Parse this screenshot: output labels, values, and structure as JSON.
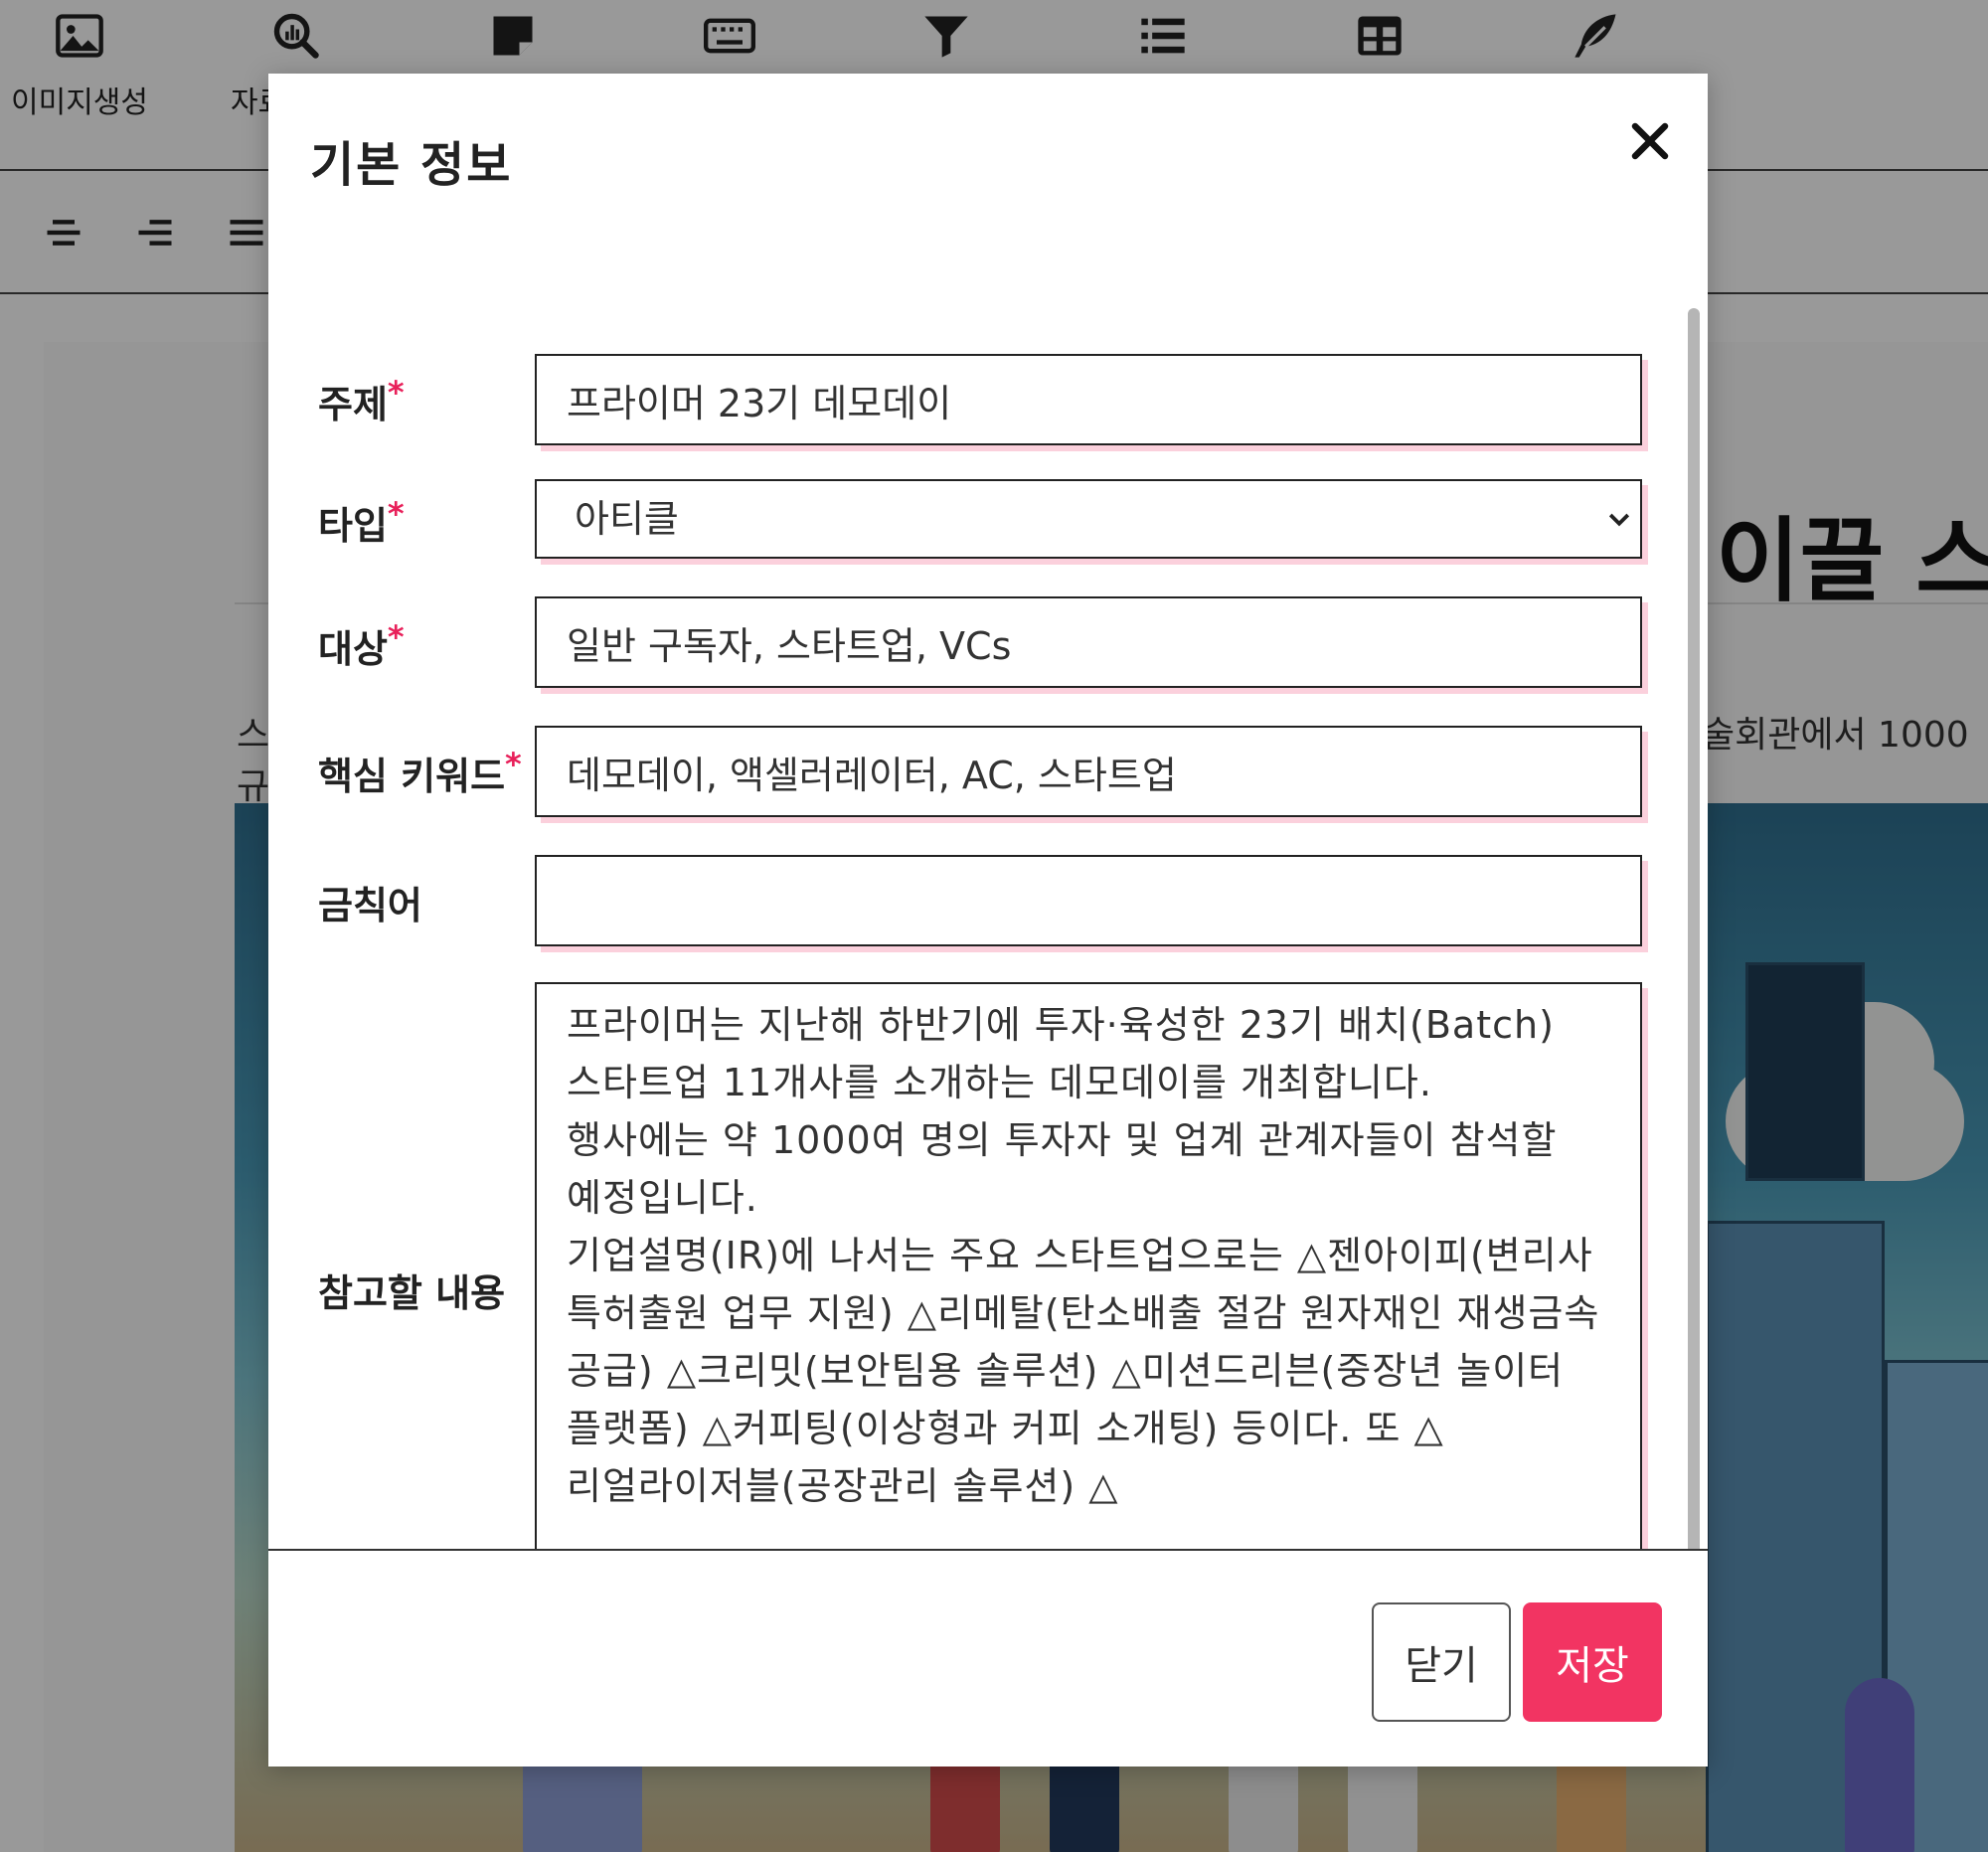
{
  "toolbar": {
    "items": [
      {
        "label": "이미지생성",
        "icon": "image-icon"
      },
      {
        "label": "자료",
        "icon": "search-chart-icon"
      },
      {
        "label": "",
        "icon": "note-icon"
      },
      {
        "label": "",
        "icon": "keyboard-icon"
      },
      {
        "label": "",
        "icon": "filter-icon"
      },
      {
        "label": "",
        "icon": "list-icon"
      },
      {
        "label": "",
        "icon": "table-icon"
      },
      {
        "label": "",
        "icon": "feather-icon"
      }
    ]
  },
  "format_bar": {
    "icons": [
      "align-center-icon",
      "align-right-icon",
      "align-justify-icon"
    ]
  },
  "document": {
    "title_fragment": "이끌 스",
    "text_fragment_right": "술회관에서 1000",
    "text_fragment_left_1": "스",
    "text_fragment_left_2": "규"
  },
  "modal": {
    "title": "기본 정보",
    "fields": {
      "topic": {
        "label": "주제",
        "required_mark": "*",
        "value": "프라이머 23기 데모데이"
      },
      "type": {
        "label": "타입",
        "required_mark": "*",
        "value": "아티클",
        "options": [
          "아티클"
        ]
      },
      "audience": {
        "label": "대상",
        "required_mark": "*",
        "value": "일반 구독자, 스타트업, VCs"
      },
      "keywords": {
        "label": "핵심 키워드",
        "required_mark": "*",
        "value": "데모데이, 액셀러레이터, AC, 스타트업"
      },
      "banned": {
        "label": "금칙어",
        "value": ""
      },
      "reference": {
        "label": "참고할 내용",
        "value": "프라이머는 지난해 하반기에 투자·육성한 23기 배치(Batch) 스타트업 11개사를 소개하는 데모데이를 개최합니다.\n행사에는 약 1000여 명의 투자자 및 업계 관계자들이 참석할 예정입니다.\n기업설명(IR)에 나서는 주요 스타트업으로는 △젠아이피(변리사 특허출원 업무 지원) △리메탈(탄소배출 절감 원자재인 재생금속 공급) △크리밋(보안팀용 솔루션) △미션드리븐(중장년 놀이터 플랫폼) △커피팅(이상형과 커피 소개팅) 등이다. 또 △리얼라이저블(공장관리 솔루션) △"
      }
    },
    "buttons": {
      "close": "닫기",
      "save": "저장"
    },
    "colors": {
      "accent": "#f23462",
      "focus_shadow": "#fbd0dc",
      "required": "#e8205a"
    }
  }
}
